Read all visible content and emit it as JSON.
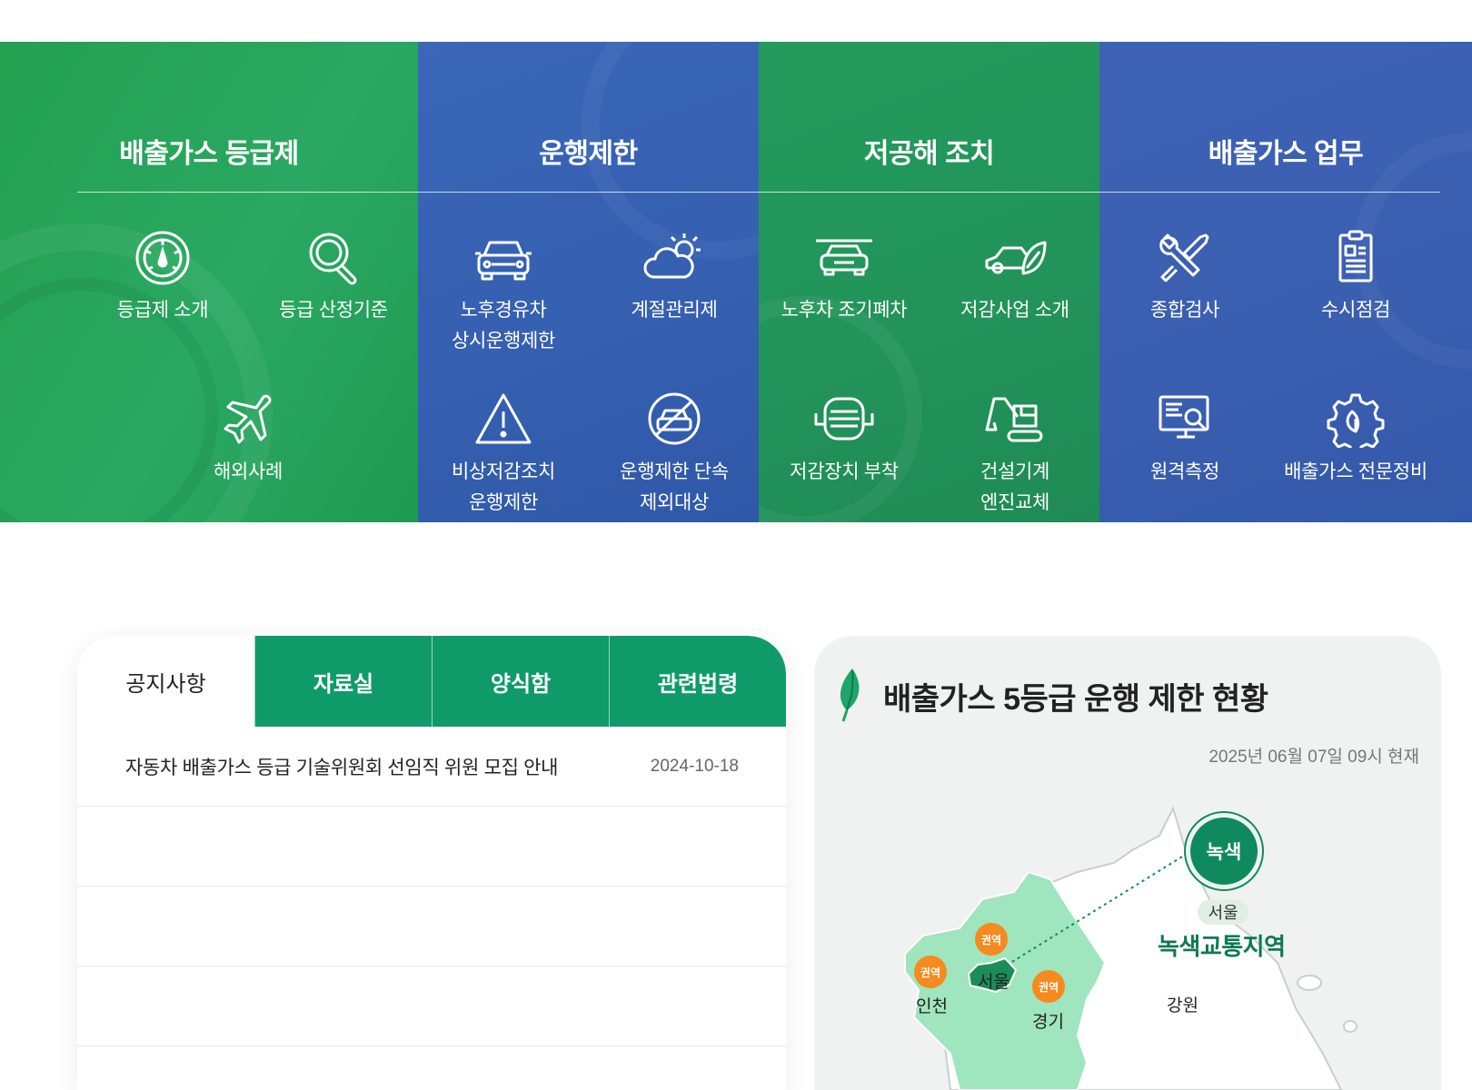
{
  "categories": [
    {
      "title": "배출가스 등급제",
      "items": [
        {
          "label": "등급제 소개",
          "icon": "gauge-icon"
        },
        {
          "label": "등급 산정기준",
          "icon": "magnifier-icon"
        },
        {
          "label": "해외사례",
          "icon": "airplane-icon"
        }
      ]
    },
    {
      "title": "운행제한",
      "items": [
        {
          "label": "노후경유차\n상시운행제한",
          "icon": "car-icon"
        },
        {
          "label": "계절관리제",
          "icon": "cloud-sun-icon"
        },
        {
          "label": "비상저감조치\n운행제한",
          "icon": "warning-icon"
        },
        {
          "label": "운행제한 단속\n제외대상",
          "icon": "no-car-icon"
        }
      ]
    },
    {
      "title": "저공해 조치",
      "items": [
        {
          "label": "노후차 조기폐차",
          "icon": "scrap-car-icon"
        },
        {
          "label": "저감사업 소개",
          "icon": "eco-car-icon"
        },
        {
          "label": "저감장치 부착",
          "icon": "filter-device-icon"
        },
        {
          "label": "건설기계\n엔진교체",
          "icon": "excavator-icon"
        }
      ]
    },
    {
      "title": "배출가스 업무",
      "items": [
        {
          "label": "종합검사",
          "icon": "tools-icon"
        },
        {
          "label": "수시점검",
          "icon": "clipboard-icon"
        },
        {
          "label": "원격측정",
          "icon": "monitor-search-icon"
        },
        {
          "label": "배출가스 전문정비",
          "icon": "gear-leaf-icon"
        }
      ]
    }
  ],
  "board": {
    "tabs": [
      "공지사항",
      "자료실",
      "양식함",
      "관련법령"
    ],
    "active_tab": "공지사항",
    "rows": [
      {
        "title": "자동차 배출가스 등급 기술위원회 선임직 위원 모집 안내",
        "date": "2024-10-18"
      },
      {
        "title": "",
        "date": ""
      },
      {
        "title": "",
        "date": ""
      },
      {
        "title": "",
        "date": ""
      }
    ]
  },
  "map_card": {
    "title": "배출가스 5등급 운행 제한 현황",
    "timestamp": "2025년 06월 07일 09시 현재",
    "green_badge": "녹색",
    "seoul_pill": "서울",
    "zone_label": "녹색교통지역",
    "region_badge": "권역",
    "regions": {
      "incheon": "인천",
      "seoul": "서울",
      "gyeonggi": "경기",
      "gangwon": "강원"
    },
    "colors": {
      "metro": "#9fe5bd",
      "seoul": "#1b8c5a",
      "badge": "#f58a1f",
      "green": "#0f8a5e"
    }
  }
}
